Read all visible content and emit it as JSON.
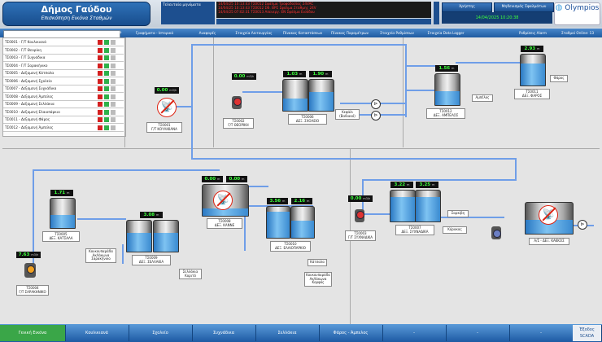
{
  "header": {
    "title": "Δήμος Γαύδου",
    "subtitle": "Επισκόπηση Εικόνα Σταθμών",
    "alarm_label": "Τελευταία μηνύματα",
    "alarms": [
      "14/04/25  10:13:43  ΤΣ0012 Σφάλμα Τροφοδοσίας 24VAC",
      "14/04/25  10:13:43  ΤΣ0012 ΣΦ. ΒΡΣ  Σφάλμα Στάθμης 24V",
      "14/04/25  07:02:31  ΤΣ0013 Απενεργ. ΕΝ  Σφάλμα Εισόδου"
    ],
    "user_button": "Χρήστης",
    "status_button": "Μηδενισμός Σφαλμάτων",
    "clock": "14/04/2025  10:20:38",
    "logo": "Olympios"
  },
  "toolbar": {
    "search_placeholder": "",
    "menus": [
      "Γραφήματα - Ιστορικά",
      "Αναφορές",
      "Στοιχεία Λειτουργίας",
      "Πίνακας Καταστάσεων",
      "Πίνακας Παραμέτρων",
      "Στοιχεία Ρυθμίσεων",
      "Στοιχεία Data Logger",
      "Ρυθμίσεις Alarm",
      "Σταθμοί Online: 13"
    ]
  },
  "stations": [
    {
      "name": "ΤΣ0001 - Γ/Τ Κουλικιανά",
      "alarm": true
    },
    {
      "name": "ΤΣ0002 - Γ/Τ Θεορίκη",
      "alarm": true
    },
    {
      "name": "ΤΣ0003 - Γ/Τ Συχνάδικα",
      "alarm": true
    },
    {
      "name": "ΤΣ0004 - Γ/Τ Σαρακήνικο",
      "alarm": true
    },
    {
      "name": "ΤΣ0005 - Δεξαμενή Κάτσαλα",
      "alarm": true
    },
    {
      "name": "ΤΣ0006 - Δεξαμενή Σχολείο",
      "alarm": true
    },
    {
      "name": "ΤΣ0007 - Δεξαμενή Συχνάδικα",
      "alarm": true
    },
    {
      "name": "ΤΣ0008 - Δεξαμενή Άμπελος",
      "alarm": true
    },
    {
      "name": "ΤΣ0009 - Δεξαμενή Σελλάκια",
      "alarm": true
    },
    {
      "name": "ΤΣ0010 - Δεξαμενή Ελαιοπάρκιο",
      "alarm": true
    },
    {
      "name": "ΤΣ0011 - Δεξαμενή Φάρος",
      "alarm": true
    },
    {
      "name": "ΤΣ0012 - Δεξαμενή Άμπελος",
      "alarm": true
    }
  ],
  "levels": {
    "l1": {
      "value": "0.00",
      "unit": "m3/h"
    },
    "l2": {
      "value": "0.00",
      "unit": "m3/h"
    },
    "l3": {
      "value": "1.03",
      "unit": "m"
    },
    "l4": {
      "value": "1.90",
      "unit": "m"
    },
    "l5": {
      "value": "1.56",
      "unit": "m"
    },
    "l6": {
      "value": "2.93",
      "unit": "m"
    },
    "l7": {
      "value": "1.71",
      "unit": "m"
    },
    "l8": {
      "value": "3.08",
      "unit": "m"
    },
    "l9": {
      "value": "0.00",
      "unit": "m"
    },
    "l10": {
      "value": "0.00",
      "unit": "m"
    },
    "l11": {
      "value": "3.56",
      "unit": "m"
    },
    "l12": {
      "value": "2.16",
      "unit": "m"
    },
    "l13": {
      "value": "0.00",
      "unit": "m3/h"
    },
    "l14": {
      "value": "3.22",
      "unit": "m"
    },
    "l15": {
      "value": "3.25",
      "unit": "m"
    },
    "l16": {
      "value": "7.63",
      "unit": "m3/h"
    }
  },
  "labels": {
    "s1": "ΤΣ0001\nΓ/Τ ΚΟΥΛΙΚΙΑΝΑ",
    "s2": "ΤΣ0002\nΓ/Τ ΘΕΟΡΙΚΗ",
    "s6": "ΤΣ0006\nΔΕΞ. ΣΧΟΛΕΙΟ",
    "s12": "ΤΣ0012\nΔΕΞ. ΑΜΠΕΛΟΣ",
    "s11": "ΤΣ0011\nΔΕΞ. ΦΑΡΟΣ",
    "s5": "ΤΣ0005\nΔΕΞ. ΚΑΤΣΑΛΑ",
    "s9": "ΤΣ0009\nΔΕΞ. ΣΕΛΛΑΚΙΑ",
    "s8": "ΤΣ0008\nΔΕΞ. ΚΑΝΝΕ",
    "s10": "ΤΣ0010\nΔΕΞ. ΕΛΑΙΟΠΑΡΚΙΟ",
    "s3": "ΤΣ0003\nΓ/Τ ΣΥΧΝΑΔΙΚΑ",
    "s7": "ΤΣ0007\nΔΕΞ. ΣΥΧΝΑΔΙΚΑ",
    "s13": "Α/Σ - ΔΕΞ. ΚΑΚΚΟΣ",
    "s4": "ΤΣ0004\nΓ/Τ ΣΑΡΑΚΗΝΙΚΟ",
    "n_kefali": "Κεφάλι\n(Βαθιακό)",
    "n_ampelos": "Αμπέλος",
    "n_faros": "Φάρος",
    "n_kourfa": "Κουκουπαράδα\nΑκ/Ιάκωνα\nΣαρακήνικο",
    "n_sellakia": "Σελλάκια\nΚοριτό",
    "n_katsala": "Κάτσαλα",
    "n_korfos": "Κουκουπαράδα\nΑκ/Ιάκωνα\nΚορφός",
    "n_sarki": "Σαρκίβη",
    "n_korakas": "Κόρακας"
  },
  "footer": {
    "tabs": [
      "Γενική Εικόνα",
      "Κουλικιανά",
      "Σχολείο",
      "Συχνάδικα",
      "Σελλάκια",
      "Φάρος - Άμπελος",
      "-",
      "-",
      "-"
    ],
    "exit": "Έξοδος SCADA"
  }
}
